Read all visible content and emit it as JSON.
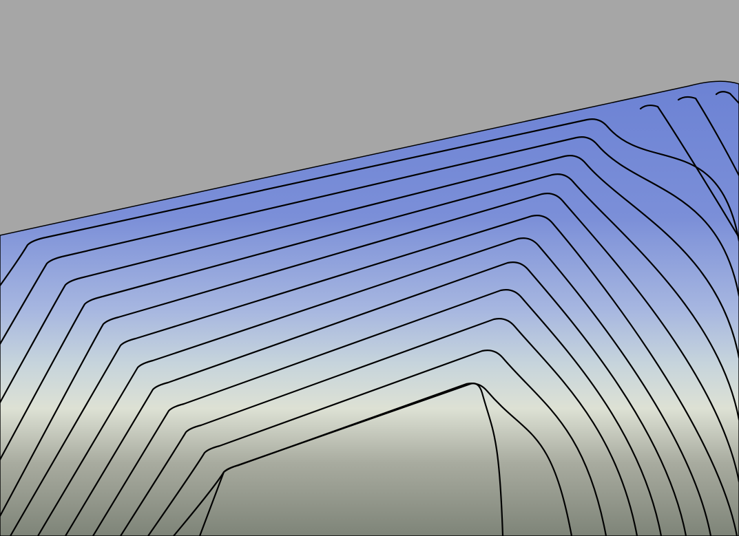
{
  "scene": {
    "background_color": "#a6a6a6",
    "surface_gradient_colors": [
      "#6c82d4",
      "#7b8fd8",
      "#a6b6e0",
      "#c6d4dc",
      "#dde1d4",
      "#a8ab9f",
      "#7e8478"
    ],
    "contour_color": "#000000",
    "contour_line_count": 13
  }
}
